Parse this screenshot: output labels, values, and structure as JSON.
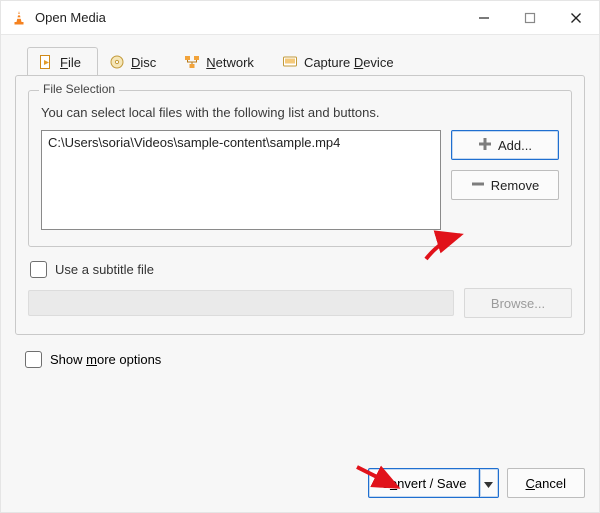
{
  "window": {
    "title": "Open Media"
  },
  "tabs": {
    "file": "File",
    "disc": "Disc",
    "network": "Network",
    "capture": "Capture Device"
  },
  "file_selection": {
    "legend": "File Selection",
    "hint": "You can select local files with the following list and buttons.",
    "files": [
      "C:\\Users\\soria\\Videos\\sample-content\\sample.mp4"
    ],
    "add_label": "Add...",
    "remove_label": "Remove"
  },
  "subtitle": {
    "checkbox_label": "Use a subtitle file",
    "browse_label": "Browse..."
  },
  "more_options_label": "Show more options",
  "actions": {
    "convert_save": "Convert / Save",
    "cancel": "Cancel"
  }
}
